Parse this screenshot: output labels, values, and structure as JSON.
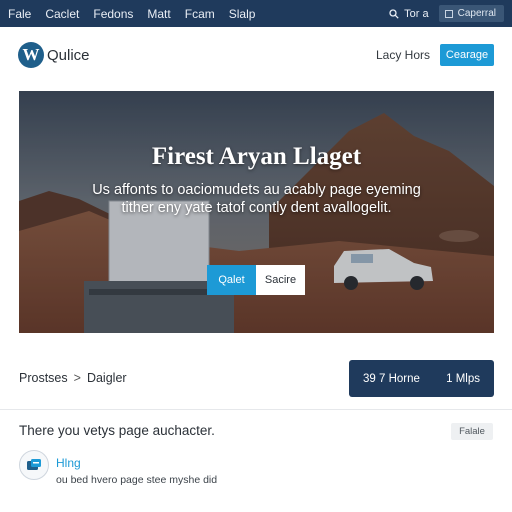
{
  "topbar": {
    "menu": [
      "Fale",
      "Caclet",
      "Fedons",
      "Matt",
      "Fcam",
      "Slalp"
    ],
    "search_label": "Tor a",
    "account_label": "Caperral"
  },
  "header": {
    "site_name": "Qulice",
    "link_label": "Lacy Hors",
    "button_label": "Cearage"
  },
  "hero": {
    "title": "Firest Aryan Llaget",
    "text": "Us affonts to oaciomudets au acably page eyeming tither eny yate tatof contly dent avallogelit.",
    "primary_button": "Qalet",
    "secondary_button": "Sacire"
  },
  "breadcrumb": {
    "first": "Prostses",
    "separator": ">",
    "second": "Daigler"
  },
  "stats": {
    "left": "39 7 Horne",
    "right": "1 Mlps"
  },
  "content": {
    "line": "There you vetys page auchacter.",
    "tag": "Falale"
  },
  "card": {
    "title": "Hlng",
    "subtitle": "ou bed hvero page stee myshe did"
  },
  "colors": {
    "admin_bar": "#1f3a5c",
    "accent": "#1d9ad6",
    "stats_panel": "#1f3a5c"
  },
  "icons": {
    "logo": "wordpress-logo-icon",
    "search": "search-icon",
    "card": "user-card-icon"
  }
}
